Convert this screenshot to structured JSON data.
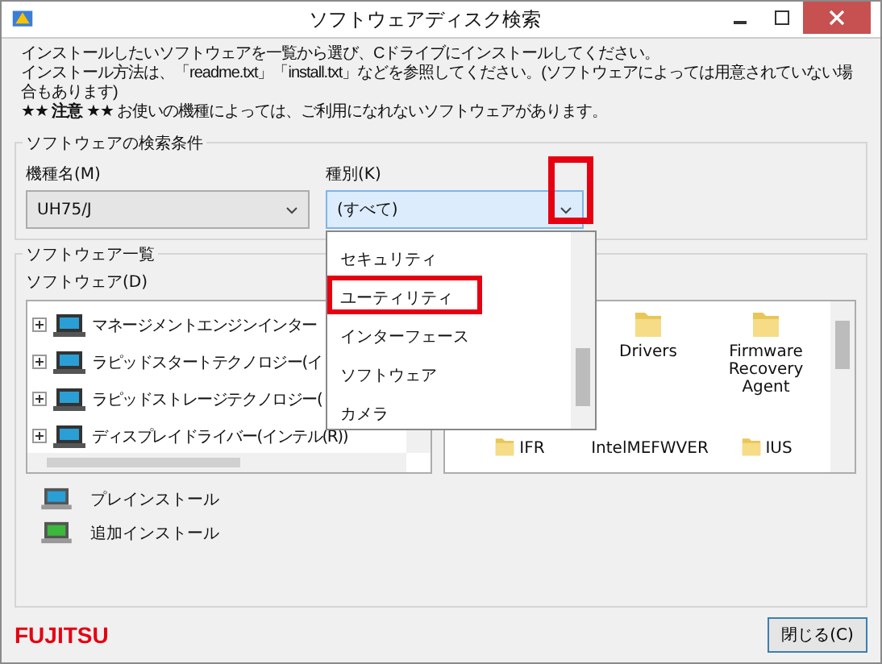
{
  "window": {
    "title": "ソフトウェアディスク検索"
  },
  "instructions": [
    "インストールしたいソフトウェアを一覧から選び、Cドライブにインストールしてください。",
    "インストール方法は、「readme.txt」「install.txt」などを参照してください。(ソフトウェアによっては用意されていない場合もあります)",
    "**★★ 注意 ★★** お使いの機種によっては、ご利用になれないソフトウェアがあります。"
  ],
  "search": {
    "legend": "ソフトウェアの検索条件",
    "model": {
      "label": "機種名(M)",
      "value": "UH75/J"
    },
    "kind": {
      "label": "種別(K)",
      "value": "(すべて)",
      "arrow_highlighted": true,
      "options": [
        {
          "label": "セキュリティ",
          "highlighted": false
        },
        {
          "label": "ユーティリティ",
          "highlighted": true
        },
        {
          "label": "インターフェース",
          "highlighted": false
        },
        {
          "label": "ソフトウェア",
          "highlighted": false
        },
        {
          "label": "カメラ",
          "highlighted": false
        }
      ]
    }
  },
  "software": {
    "legend": "ソフトウェア一覧",
    "tree_label": "ソフトウェア(D)",
    "tree": [
      {
        "label": "マネージメントエンジンインター",
        "expanded": false
      },
      {
        "label": "ラピッドスタートテクノロジー(イ",
        "expanded": false
      },
      {
        "label": "ラピッドストレージテクノロジー(",
        "expanded": false
      },
      {
        "label": "ディスプレイドライバー(インテル(R))",
        "expanded": false
      }
    ],
    "folders": [
      {
        "label": "Drivers"
      },
      {
        "label": "Firmware Recovery Agent"
      },
      {
        "label": "IFR"
      },
      {
        "label": "IntelMEFWVER"
      },
      {
        "label": "IUS"
      }
    ],
    "legend_items": [
      {
        "kind": "preinstall",
        "label": "プレインストール"
      },
      {
        "kind": "additional",
        "label": "追加インストール"
      }
    ]
  },
  "footer": {
    "logo": "FUJITSU",
    "close_button": "閉じる(C)"
  }
}
